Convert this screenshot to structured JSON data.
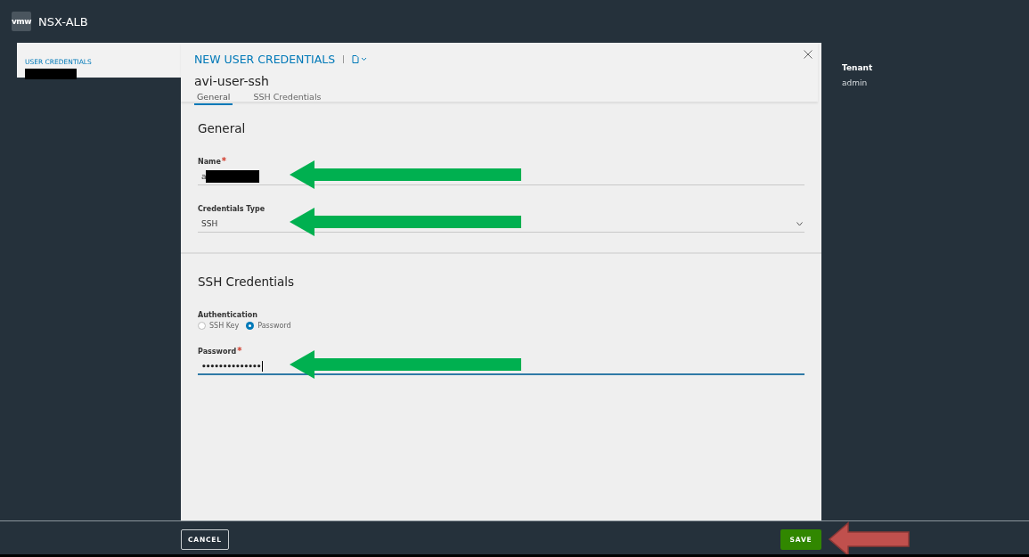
{
  "app": {
    "logo": "vmw",
    "title": "NSX-ALB"
  },
  "breadcrumb": {
    "label": "USER CREDENTIALS",
    "redacted": true
  },
  "modal": {
    "title": "NEW USER CREDENTIALS",
    "object_name": "avi-user-ssh",
    "tabs": [
      {
        "label": "General",
        "selected": true
      },
      {
        "label": "SSH Credentials",
        "selected": false
      }
    ]
  },
  "sections": [
    {
      "title": "General",
      "fields": [
        {
          "kind": "text",
          "label": "Name",
          "required_mark": "*",
          "value": "a",
          "redacted": true,
          "focused": false,
          "annotated": true
        },
        {
          "kind": "select",
          "label": "Credentials Type",
          "value": "SSH",
          "focused": false,
          "annotated": true
        }
      ]
    },
    {
      "title": "SSH Credentials",
      "fields": [
        {
          "kind": "radio",
          "label": "Authentication",
          "options": [
            {
              "label": "SSH Key",
              "selected": false
            },
            {
              "label": "Password",
              "selected": true
            }
          ]
        },
        {
          "kind": "password",
          "label": "Password",
          "required_mark": "*",
          "value": "••••••••••••••",
          "focused": true,
          "annotated": true
        }
      ]
    }
  ],
  "tenant": {
    "label": "Tenant",
    "value": "admin"
  },
  "footer": {
    "buttons": [
      {
        "kind": "cancel",
        "label": "CANCEL"
      },
      {
        "kind": "save",
        "label": "SAVE",
        "annotated": true
      }
    ]
  }
}
